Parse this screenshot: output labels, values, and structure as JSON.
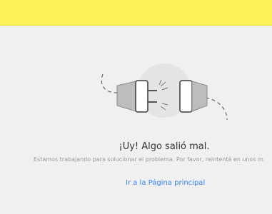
{
  "header": {
    "color": "#fff159"
  },
  "illustration": {
    "icon": "unplugged-cable-icon"
  },
  "error": {
    "title": "¡Uy! Algo salió mal.",
    "message": "Estamos trabajando para solucionar el problema. Por favor, reintentá en unos m"
  },
  "actions": {
    "home_link": "Ir a la Página principal",
    "link_color": "#3483fa"
  }
}
